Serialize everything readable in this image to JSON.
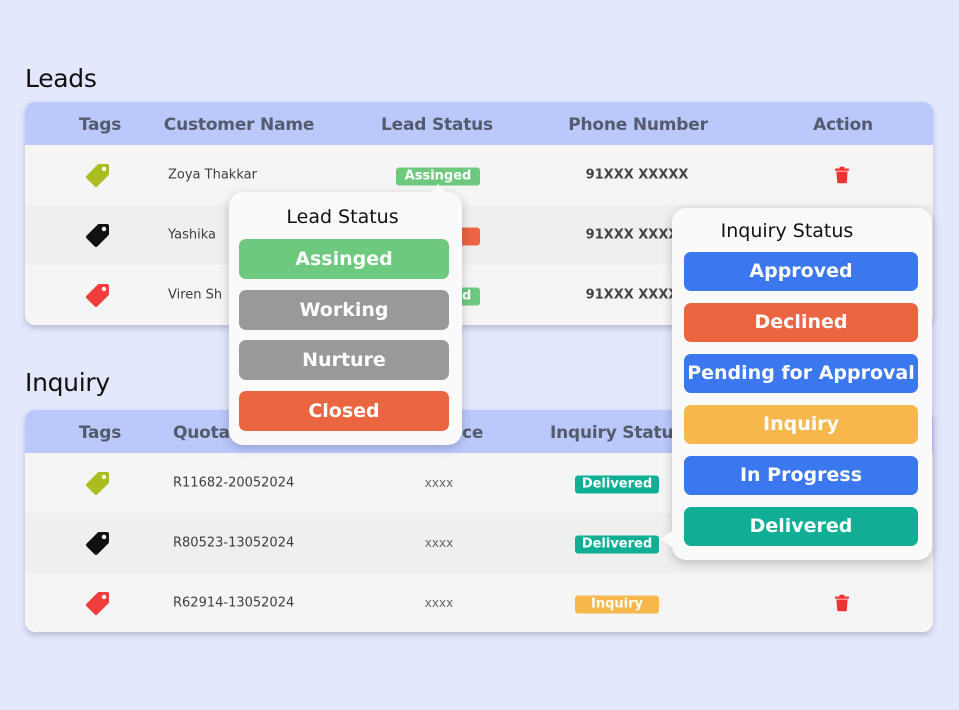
{
  "colors": {
    "background": "#e3e8fd",
    "table_header": "#bac8fb",
    "assigned": "#6dc97e",
    "working": "#999999",
    "nurture": "#999999",
    "closed": "#ea6540",
    "approved": "#3b77ee",
    "declined": "#ea6540",
    "pending": "#3b77ee",
    "inquiry": "#f6b84c",
    "in_progress": "#3b77ee",
    "delivered": "#10af95",
    "tag_green": "#aabc20",
    "tag_black": "#111111",
    "tag_red": "#f23d3d",
    "trash": "#f23232"
  },
  "leads": {
    "title": "Leads",
    "columns": [
      "Tags",
      "Customer Name",
      "Lead Status",
      "Phone Number",
      "Action"
    ],
    "rows": [
      {
        "tag_color": "green",
        "customer_name": "Zoya Thakkar",
        "lead_status": "Assinged",
        "lead_status_color": "#6dc97e",
        "phone": "91XXX XXXXX",
        "action_icon": "trash-icon"
      },
      {
        "tag_color": "black",
        "customer_name": "Yashika",
        "lead_status": "",
        "lead_status_color": "#ea6540",
        "phone": "91XXX XXXXX",
        "action_icon": ""
      },
      {
        "tag_color": "red",
        "customer_name": "Viren Sh",
        "lead_status": "Assinged",
        "lead_status_color": "#6dc97e",
        "phone": "91XXX XXXXX",
        "action_icon": ""
      }
    ]
  },
  "lead_status_popup": {
    "title": "Lead Status",
    "options": [
      {
        "label": "Assinged",
        "color": "#6dc97e"
      },
      {
        "label": "Working",
        "color": "#999999"
      },
      {
        "label": "Nurture",
        "color": "#999999"
      },
      {
        "label": "Closed",
        "color": "#ea6540"
      }
    ]
  },
  "inquiry": {
    "title": "Inquiry",
    "columns": [
      "Tags",
      "Quota",
      "ce",
      "Inquiry Status"
    ],
    "rows": [
      {
        "tag_color": "green",
        "quotation": "R11682-20052024",
        "price": "xxxx",
        "inquiry_status": "Delivered",
        "status_color": "#10af95",
        "action_icon": ""
      },
      {
        "tag_color": "black",
        "quotation": "R80523-13052024",
        "price": "xxxx",
        "inquiry_status": "Delivered",
        "status_color": "#10af95",
        "action_icon": ""
      },
      {
        "tag_color": "red",
        "quotation": "R62914-13052024",
        "price": "xxxx",
        "inquiry_status": "Inquiry",
        "status_color": "#f6b84c",
        "action_icon": "trash-icon"
      }
    ]
  },
  "inquiry_status_popup": {
    "title": "Inquiry Status",
    "options": [
      {
        "label": "Approved",
        "color": "#3b77ee"
      },
      {
        "label": "Declined",
        "color": "#ea6540"
      },
      {
        "label": "Pending for Approval",
        "color": "#3b77ee"
      },
      {
        "label": "Inquiry",
        "color": "#f6b84c"
      },
      {
        "label": "In Progress",
        "color": "#3b77ee"
      },
      {
        "label": "Delivered",
        "color": "#10af95"
      }
    ]
  }
}
